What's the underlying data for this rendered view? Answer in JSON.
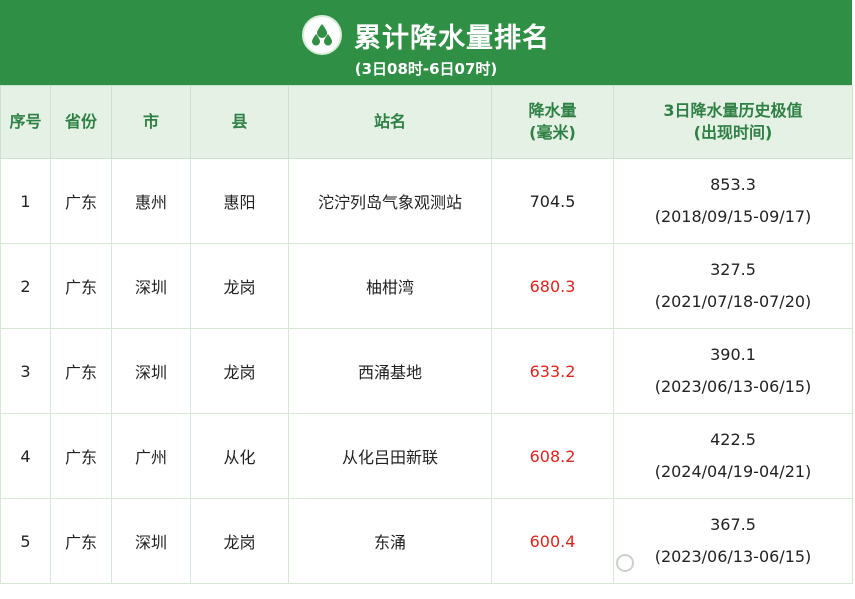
{
  "header": {
    "title": "累计降水量排名",
    "subtitle": "(3日08时-6日07时)"
  },
  "table": {
    "headers": {
      "rank": "序号",
      "province": "省份",
      "city": "市",
      "county": "县",
      "station": "站名",
      "precip_line1": "降水量",
      "precip_line2": "(毫米)",
      "hist_line1": "3日降水量历史极值",
      "hist_line2": "(出现时间)"
    },
    "rows": [
      {
        "rank": "1",
        "province": "广东",
        "city": "惠州",
        "county": "惠阳",
        "station": "沱泞列岛气象观测站",
        "precip": "704.5",
        "hist_value": "853.3",
        "hist_date": "(2018/09/15-09/17)"
      },
      {
        "rank": "2",
        "province": "广东",
        "city": "深圳",
        "county": "龙岗",
        "station": "柚柑湾",
        "precip": "680.3",
        "hist_value": "327.5",
        "hist_date": "(2021/07/18-07/20)"
      },
      {
        "rank": "3",
        "province": "广东",
        "city": "深圳",
        "county": "龙岗",
        "station": "西涌基地",
        "precip": "633.2",
        "hist_value": "390.1",
        "hist_date": "(2023/06/13-06/15)"
      },
      {
        "rank": "4",
        "province": "广东",
        "city": "广州",
        "county": "从化",
        "station": "从化吕田新联",
        "precip": "608.2",
        "hist_value": "422.5",
        "hist_date": "(2024/04/19-04/21)"
      },
      {
        "rank": "5",
        "province": "广东",
        "city": "深圳",
        "county": "龙岗",
        "station": "东涌",
        "precip": "600.4",
        "hist_value": "367.5",
        "hist_date": "(2023/06/13-06/15)"
      }
    ]
  },
  "colors": {
    "header_bg": "#2f8f44",
    "header_text": "#ffffff",
    "th_bg": "#e4f1e4",
    "th_text": "#2f8044",
    "highlight": "#e2231a"
  },
  "icons": {
    "title_icon": "water-drops-icon"
  }
}
